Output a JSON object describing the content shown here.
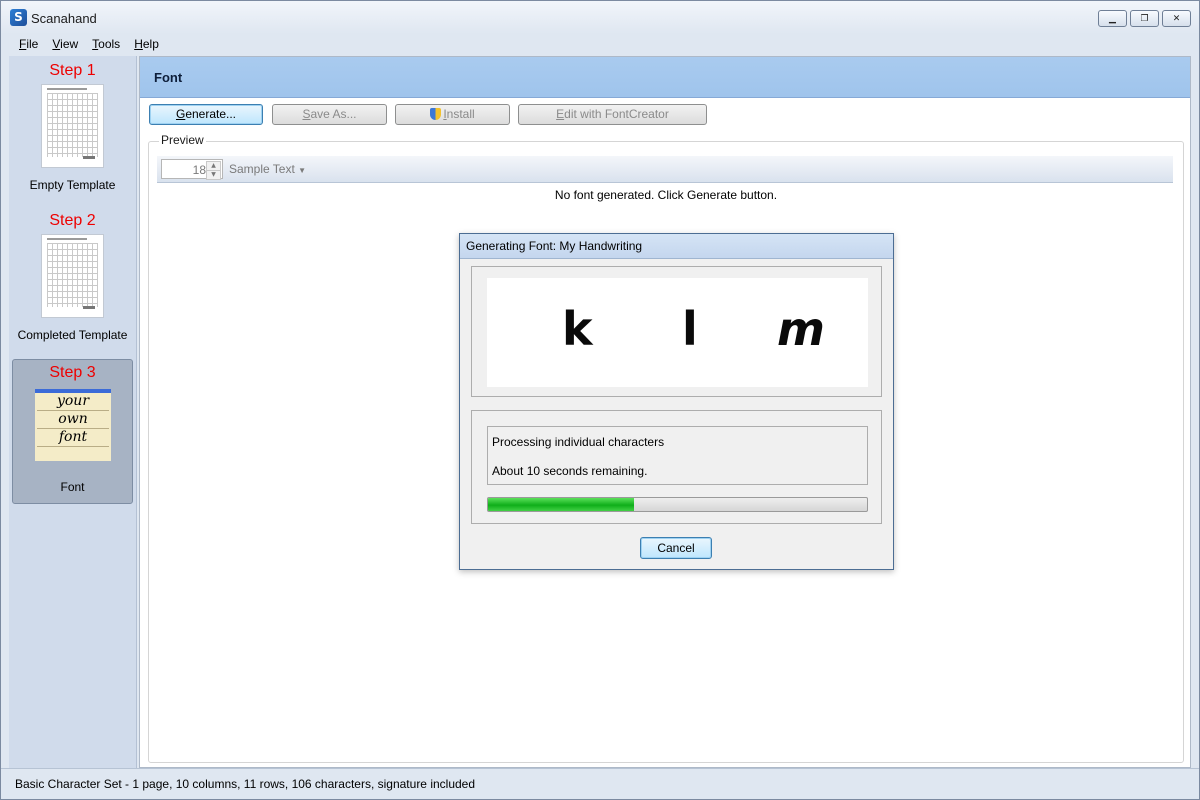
{
  "window": {
    "title": "Scanahand",
    "logo_letter": "S",
    "controls": {
      "minimize": "▁",
      "restore": "❐",
      "close": "✕"
    }
  },
  "menu": [
    {
      "accel": "F",
      "rest": "ile"
    },
    {
      "accel": "V",
      "rest": "iew"
    },
    {
      "accel": "T",
      "rest": "ools"
    },
    {
      "accel": "H",
      "rest": "elp"
    }
  ],
  "sidebar": {
    "steps": [
      {
        "label": "Step 1",
        "caption": "Empty Template"
      },
      {
        "label": "Step 2",
        "caption": "Completed Template"
      },
      {
        "label": "Step 3",
        "caption": "Font",
        "thumb_words": [
          "your",
          "own",
          "font"
        ]
      }
    ]
  },
  "page": {
    "title": "Font",
    "toolbar": {
      "generate": {
        "accel": "G",
        "rest": "enerate..."
      },
      "save_as": {
        "accel": "S",
        "rest": "ave As..."
      },
      "install": {
        "accel": "I",
        "rest": "nstall"
      },
      "edit": {
        "accel": "E",
        "rest": "dit with FontCreator"
      }
    },
    "preview": {
      "label": "Preview",
      "size": "18",
      "sample_text": "Sample Text",
      "message": "No font generated. Click Generate button."
    }
  },
  "dialog": {
    "title": "Generating Font: My Handwriting",
    "glyphs": [
      "k",
      "l",
      "m"
    ],
    "status": "Processing individual characters",
    "remaining": "About 10 seconds remaining.",
    "progress_fraction": 0.385,
    "cancel_label": "Cancel"
  },
  "statusbar": {
    "text": "Basic Character Set - 1 page, 10 columns, 11 rows, 106 characters, signature included"
  },
  "colors": {
    "step_label": "#e00000",
    "header_bg": "#a9cbef",
    "progress": "#0fae1a"
  }
}
